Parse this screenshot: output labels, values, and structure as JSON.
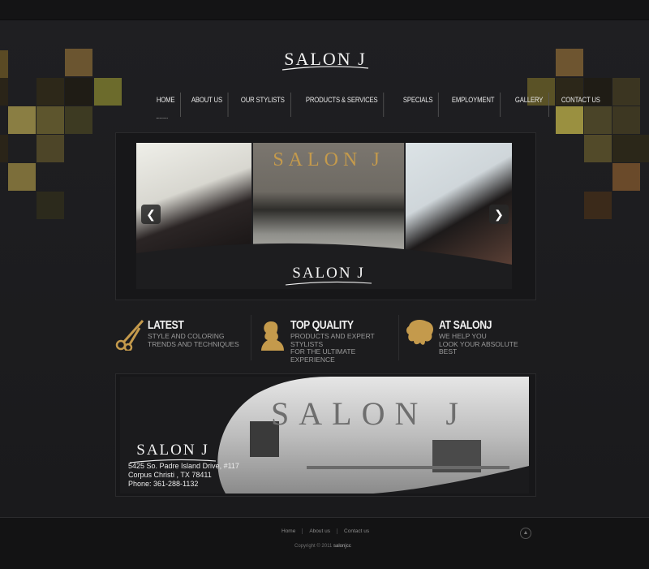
{
  "brand": {
    "logo": "SALON J",
    "accent": "#c49a4c"
  },
  "nav": {
    "items": [
      "HOME",
      "ABOUT US",
      "OUR STYLISTS",
      "PRODUCTS & SERVICES",
      "SPECIALS",
      "EMPLOYMENT",
      "GALLERY",
      "CONTACT US"
    ],
    "active": "HOME"
  },
  "slider": {
    "sign": "SALON J",
    "logo": "SALON J",
    "prev_icon": "chevron-left-icon",
    "next_icon": "chevron-right-icon"
  },
  "features": [
    {
      "title": "LATEST",
      "text": "STYLE AND COLORING\nTRENDS AND TECHNIQUES",
      "icon": "scissors-icon"
    },
    {
      "title": "TOP QUALITY",
      "text": "PRODUCTS AND EXPERT\nSTYLISTS\nFOR THE ULTIMATE EXPERIENCE",
      "icon": "woman-silhouette-icon"
    },
    {
      "title": "AT SALONJ",
      "text": "WE HELP YOU\nLOOK YOUR ABSOLUTE BEST",
      "icon": "hair-silhouette-icon"
    }
  ],
  "banner": {
    "sign": "SALON J",
    "logo": "SALON J",
    "address_line1": "5425 So. Padre Island Drive, #117",
    "address_line2": "Corpus Christi , TX 78411",
    "phone": "Phone: 361-288-1132"
  },
  "footer": {
    "links": [
      "Home",
      "About us",
      "Contact us"
    ],
    "copyright_prefix": "Copyright © 2011",
    "copyright_brand": "salonjcc",
    "top_icon": "arrow-up-icon"
  }
}
